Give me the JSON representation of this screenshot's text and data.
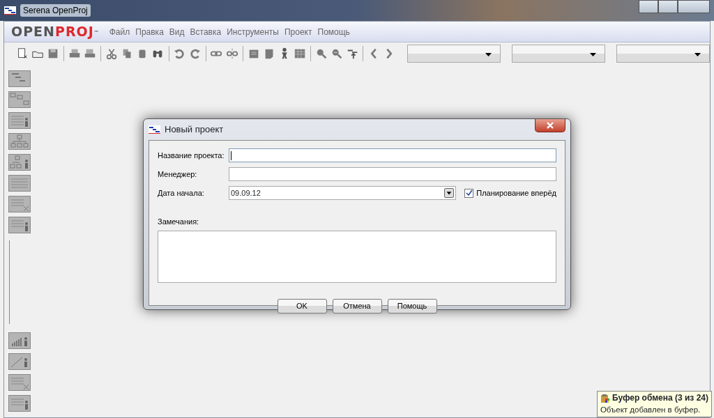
{
  "window": {
    "title": "Serena OpenProj"
  },
  "logo": {
    "part_1": "OPEN",
    "part_2": "PROJ",
    "mark": "™"
  },
  "menu": [
    "Файл",
    "Правка",
    "Вид",
    "Вставка",
    "Инструменты",
    "Проект",
    "Помощь"
  ],
  "dialog": {
    "title": "Новый проект",
    "fields": [
      {
        "kind": "text",
        "label": "Название проекта:",
        "focused": true
      },
      {
        "kind": "text",
        "label": "Менеджер:",
        "focused": false
      },
      {
        "kind": "date",
        "label": "Дата начала:",
        "value": "09.09.12",
        "focused": false
      }
    ],
    "checkbox": {
      "label": "Планирование вперёд",
      "checked": true
    },
    "notes": {
      "label": "Замечания:"
    },
    "buttons": [
      "OK",
      "Отмена",
      "Помощь"
    ]
  },
  "tooltip": {
    "title": "Буфер обмена (3 из 24)",
    "text": "Объект добавлен в буфер."
  }
}
